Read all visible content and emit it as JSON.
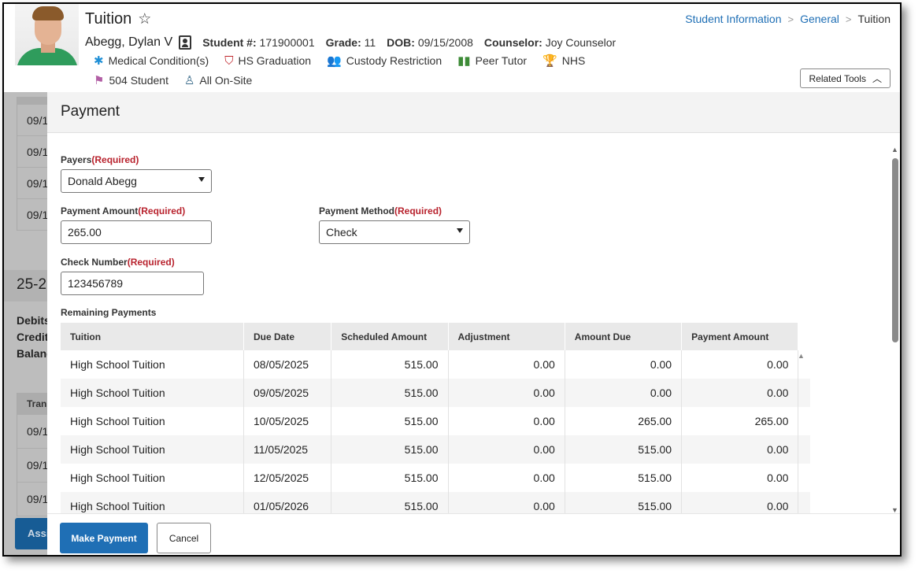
{
  "header": {
    "title": "Tuition",
    "breadcrumb": [
      "Student Information",
      "General",
      "Tuition"
    ],
    "student": {
      "name": "Abegg, Dylan V",
      "number_label": "Student #:",
      "number": "171900001",
      "grade_label": "Grade:",
      "grade": "11",
      "dob_label": "DOB:",
      "dob": "09/15/2008",
      "counselor_label": "Counselor:",
      "counselor": "Joy Counselor"
    },
    "flags_row1": [
      {
        "label": "Medical Condition(s)",
        "icon": "asterisk-icon",
        "color": "#1f8fd6"
      },
      {
        "label": "HS Graduation",
        "icon": "graduation-cap-icon",
        "color": "#c0272d"
      },
      {
        "label": "Custody Restriction",
        "icon": "people-icon",
        "color": "#d9312f"
      },
      {
        "label": "Peer Tutor",
        "icon": "book-icon",
        "color": "#3d8b37"
      },
      {
        "label": "NHS",
        "icon": "trophy-icon",
        "color": "#5aa0c8"
      }
    ],
    "flags_row2": [
      {
        "label": "504 Student",
        "icon": "flag-icon",
        "color": "#b25fa5"
      },
      {
        "label": "All On-Site",
        "icon": "person-pin-icon",
        "color": "#3a6b8a"
      }
    ],
    "related_tools": "Related Tools"
  },
  "background": {
    "rows_top": [
      "09/1",
      "09/1",
      "09/1",
      "09/1"
    ],
    "section_title": "25-2",
    "totals": [
      "Debits",
      "Credits",
      "Balanc"
    ],
    "table_head": "Trans",
    "rows_bottom": [
      "09/1",
      "09/1",
      "09/1"
    ],
    "button": "Assi"
  },
  "modal": {
    "title": "Payment",
    "payers": {
      "label": "Payers",
      "required": "(Required)",
      "value": "Donald Abegg"
    },
    "payment_amount": {
      "label": "Payment Amount",
      "required": "(Required)",
      "value": "265.00"
    },
    "payment_method": {
      "label": "Payment Method",
      "required": "(Required)",
      "value": "Check"
    },
    "check_number": {
      "label": "Check Number",
      "required": "(Required)",
      "value": "123456789"
    },
    "remaining_label": "Remaining Payments",
    "columns": [
      "Tuition",
      "Due Date",
      "Scheduled Amount",
      "Adjustment",
      "Amount Due",
      "Payment Amount"
    ],
    "rows": [
      [
        "High School Tuition",
        "08/05/2025",
        "515.00",
        "0.00",
        "0.00",
        "0.00"
      ],
      [
        "High School Tuition",
        "09/05/2025",
        "515.00",
        "0.00",
        "0.00",
        "0.00"
      ],
      [
        "High School Tuition",
        "10/05/2025",
        "515.00",
        "0.00",
        "265.00",
        "265.00"
      ],
      [
        "High School Tuition",
        "11/05/2025",
        "515.00",
        "0.00",
        "515.00",
        "0.00"
      ],
      [
        "High School Tuition",
        "12/05/2025",
        "515.00",
        "0.00",
        "515.00",
        "0.00"
      ],
      [
        "High School Tuition",
        "01/05/2026",
        "515.00",
        "0.00",
        "515.00",
        "0.00"
      ]
    ],
    "make_payment": "Make Payment",
    "cancel": "Cancel"
  },
  "colors": {
    "accent": "#1f6fb5",
    "required": "#b8222d",
    "overlay": "#bdbdbd"
  }
}
